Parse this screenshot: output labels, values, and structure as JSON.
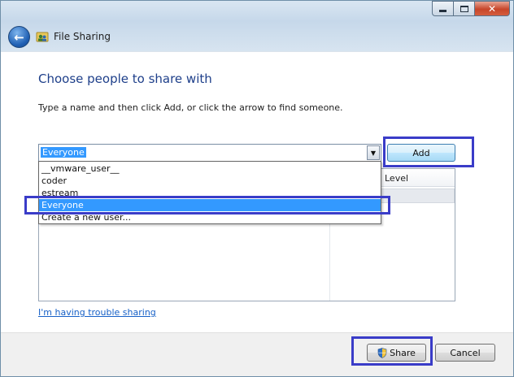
{
  "window": {
    "title": "File Sharing"
  },
  "dialog": {
    "heading": "Choose people to share with",
    "instruction": "Type a name and then click Add, or click the arrow to find someone."
  },
  "input": {
    "value": "Everyone"
  },
  "dropdown": {
    "items": [
      "__vmware_user__",
      "coder",
      "estream",
      "Everyone",
      "Create a new user..."
    ],
    "selected": "Everyone"
  },
  "add_button": {
    "label": "Add"
  },
  "table": {
    "columns": [
      "Level"
    ]
  },
  "links": {
    "trouble": "I'm having trouble sharing"
  },
  "footer": {
    "share_label": "Share",
    "cancel_label": "Cancel"
  },
  "icons": {
    "back": "back-arrow-icon",
    "app": "file-sharing-icon",
    "shield": "uac-shield-icon",
    "dropdown": "chevron-down-icon"
  },
  "colors": {
    "heading": "#1e3f8a",
    "selection": "#3399ff",
    "highlight_box": "#3a3cc8",
    "link": "#1660c7"
  }
}
